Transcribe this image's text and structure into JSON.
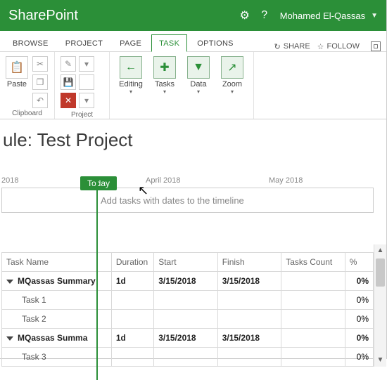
{
  "top": {
    "brand": "SharePoint",
    "user": "Mohamed El-Qassas"
  },
  "tabs": {
    "browse": "BROWSE",
    "project": "PROJECT",
    "page": "PAGE",
    "task": "TASK",
    "options": "OPTIONS",
    "share": "SHARE",
    "follow": "FOLLOW"
  },
  "ribbon": {
    "paste": "Paste",
    "clipboard": "Clipboard",
    "project_group": "Project",
    "editing": "Editing",
    "tasks": "Tasks",
    "data": "Data",
    "zoom": "Zoom"
  },
  "page": {
    "title": "ule: Test Project",
    "today": "Today",
    "timeline_placeholder": "Add tasks with dates to the timeline",
    "axis_2018": "2018",
    "axis_apr": "April 2018",
    "axis_may": "May 2018"
  },
  "grid": {
    "headers": {
      "name": "Task Name",
      "duration": "Duration",
      "start": "Start",
      "finish": "Finish",
      "tasks_count": "Tasks Count",
      "pct": "%"
    },
    "rows": [
      {
        "name": "MQassas Summary",
        "duration": "1d",
        "start": "3/15/2018",
        "finish": "3/15/2018",
        "count": "",
        "pct": "0%",
        "type": "summary"
      },
      {
        "name": "Task 1",
        "duration": "",
        "start": "",
        "finish": "",
        "count": "",
        "pct": "0%",
        "type": "sub"
      },
      {
        "name": "Task 2",
        "duration": "",
        "start": "",
        "finish": "",
        "count": "",
        "pct": "0%",
        "type": "sub"
      },
      {
        "name": "MQassas Summa",
        "duration": "1d",
        "start": "3/15/2018",
        "finish": "3/15/2018",
        "count": "",
        "pct": "0%",
        "type": "summary"
      },
      {
        "name": "Task 3",
        "duration": "",
        "start": "",
        "finish": "",
        "count": "",
        "pct": "0%",
        "type": "sub",
        "selected": true
      }
    ]
  }
}
